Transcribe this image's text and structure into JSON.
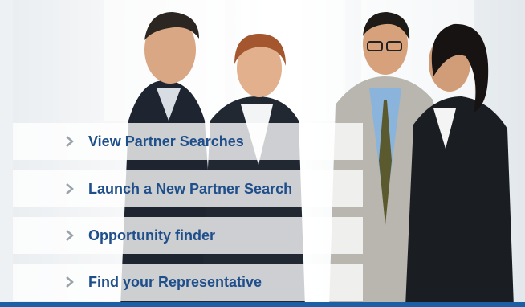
{
  "menu": {
    "items": [
      {
        "label": "View Partner Searches"
      },
      {
        "label": "Launch a New Partner Search"
      },
      {
        "label": "Opportunity finder"
      },
      {
        "label": "Find your Representative"
      }
    ]
  },
  "colors": {
    "link": "#1f4f8b",
    "chevron": "#9aa3aa",
    "accent_bar": "#1c5fa5"
  },
  "photo": {
    "icon": "business-people-photo"
  }
}
